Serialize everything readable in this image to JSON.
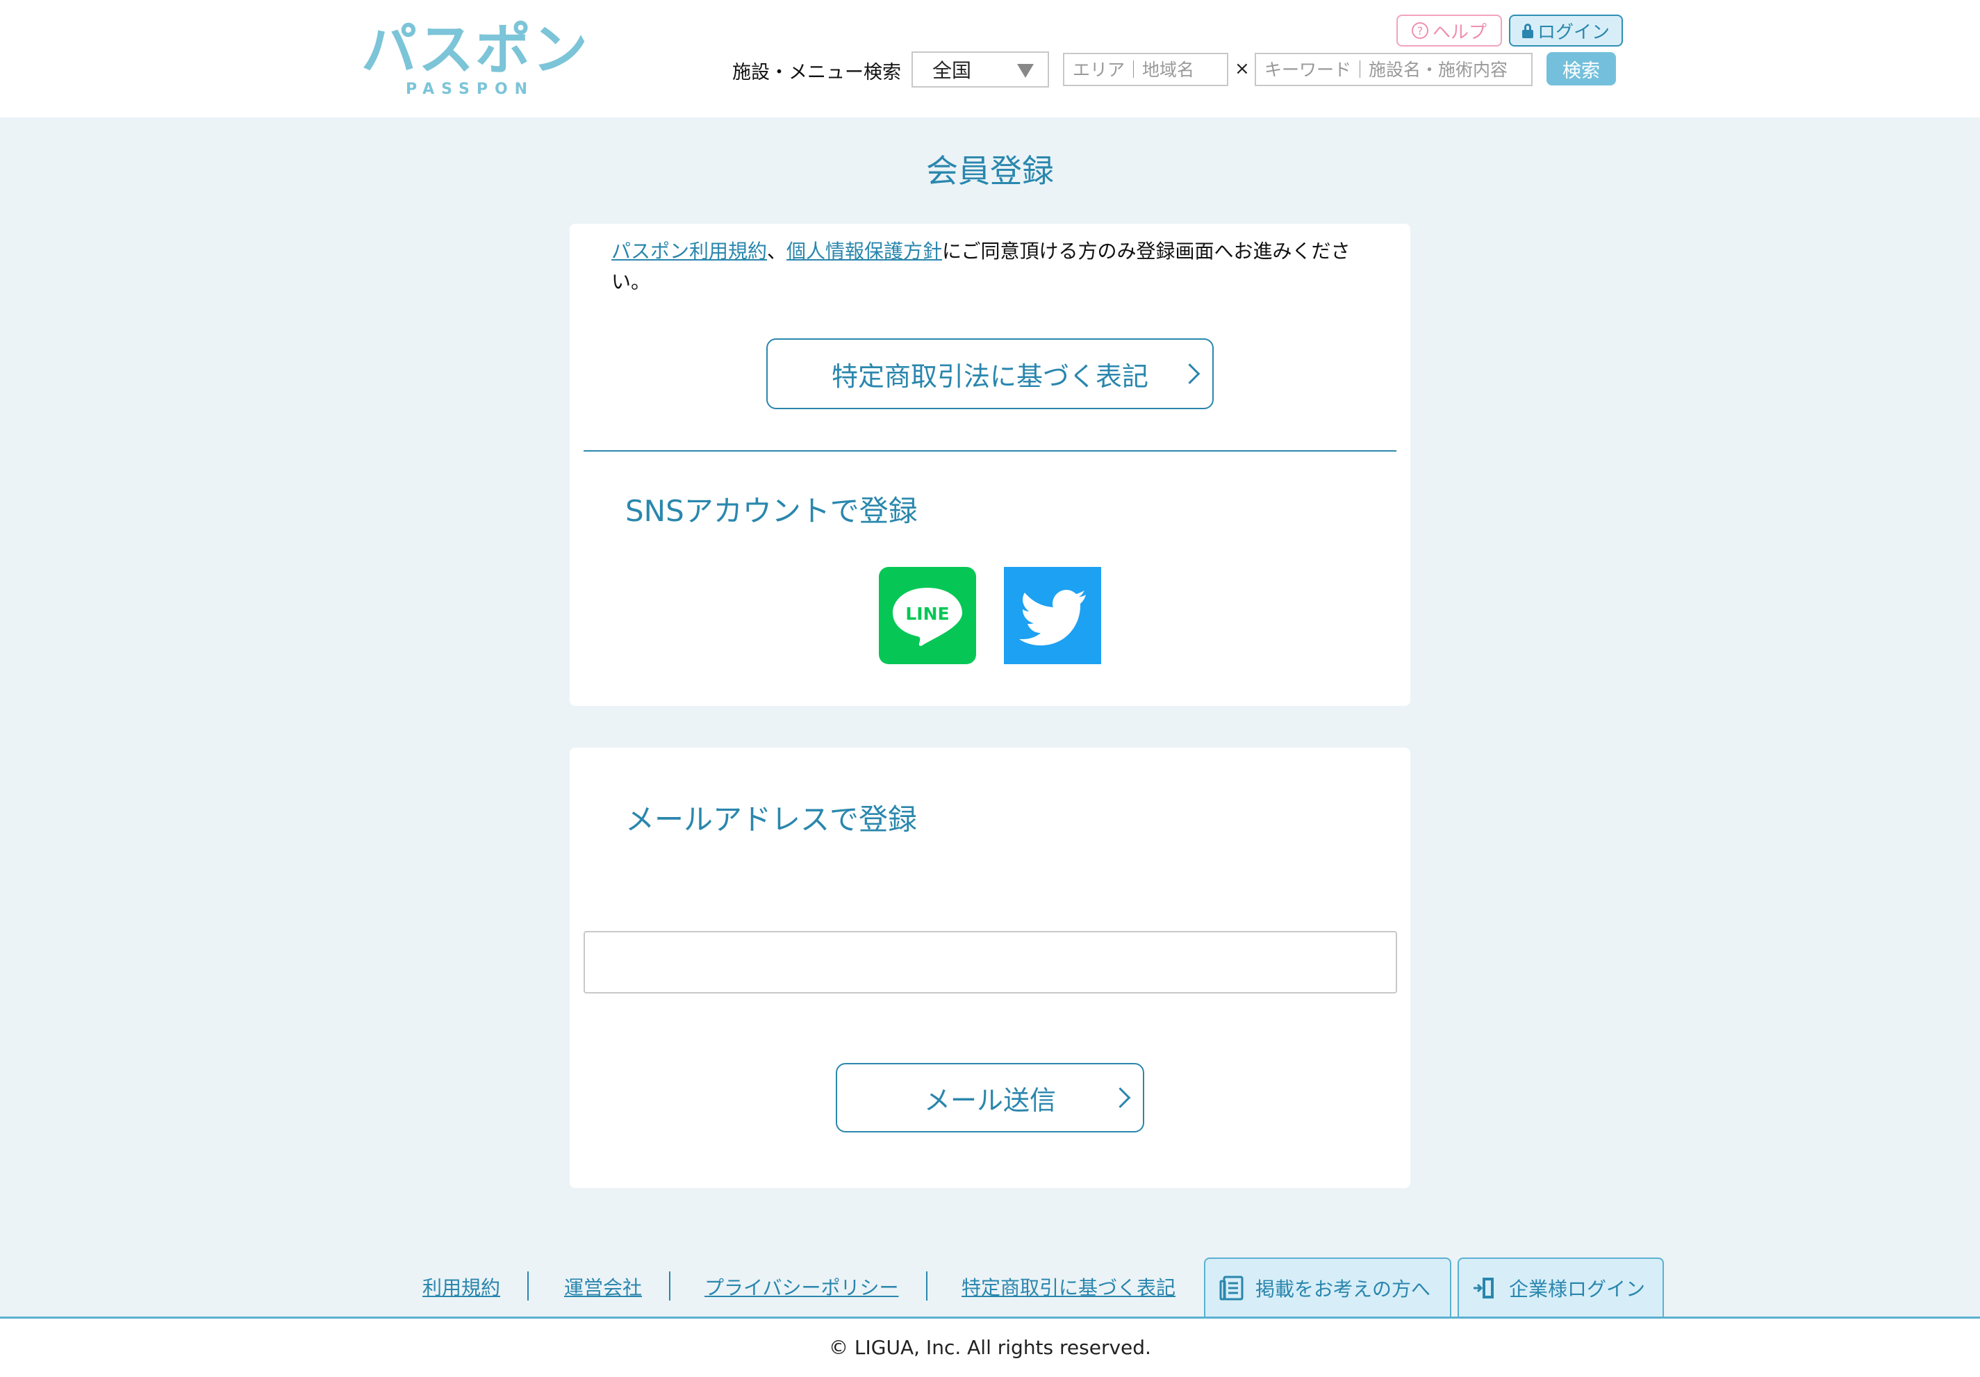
{
  "header": {
    "logo_text": "パスポン",
    "logo_sub": "PASSPON",
    "help_label": "ヘルプ",
    "login_label": "ログイン",
    "search_label": "施設・メニュー検索",
    "region_value": "全国",
    "area_placeholder": "エリア｜地域名",
    "times": "×",
    "keyword_placeholder": "キーワード｜施設名・施術内容",
    "search_button": "検索"
  },
  "main": {
    "page_title": "会員登録",
    "agree_link1": "パスポン利用規約",
    "agree_sep": "、",
    "agree_link2": "個人情報保護方針",
    "agree_text": "にご同意頂ける方のみ登録画面へお進みください。",
    "tokutei_button": "特定商取引法に基づく表記",
    "sns_heading": "SNSアカウントで登録",
    "line_label": "LINE",
    "mail_heading": "メールアドレスで登録",
    "send_button": "メール送信"
  },
  "footer": {
    "links": [
      "利用規約",
      "運営会社",
      "プライバシーポリシー",
      "特定商取引に基づく表記"
    ],
    "publish_tab": "掲載をお考えの方へ",
    "company_login_tab": "企業様ログイン",
    "copyright": "© LIGUA, Inc. All rights reserved."
  },
  "colors": {
    "accent": "#2a86ad",
    "background": "#ebf3f7",
    "line_green": "#06c755",
    "twitter_blue": "#1da1f2",
    "help_pink": "#ef8fae"
  }
}
